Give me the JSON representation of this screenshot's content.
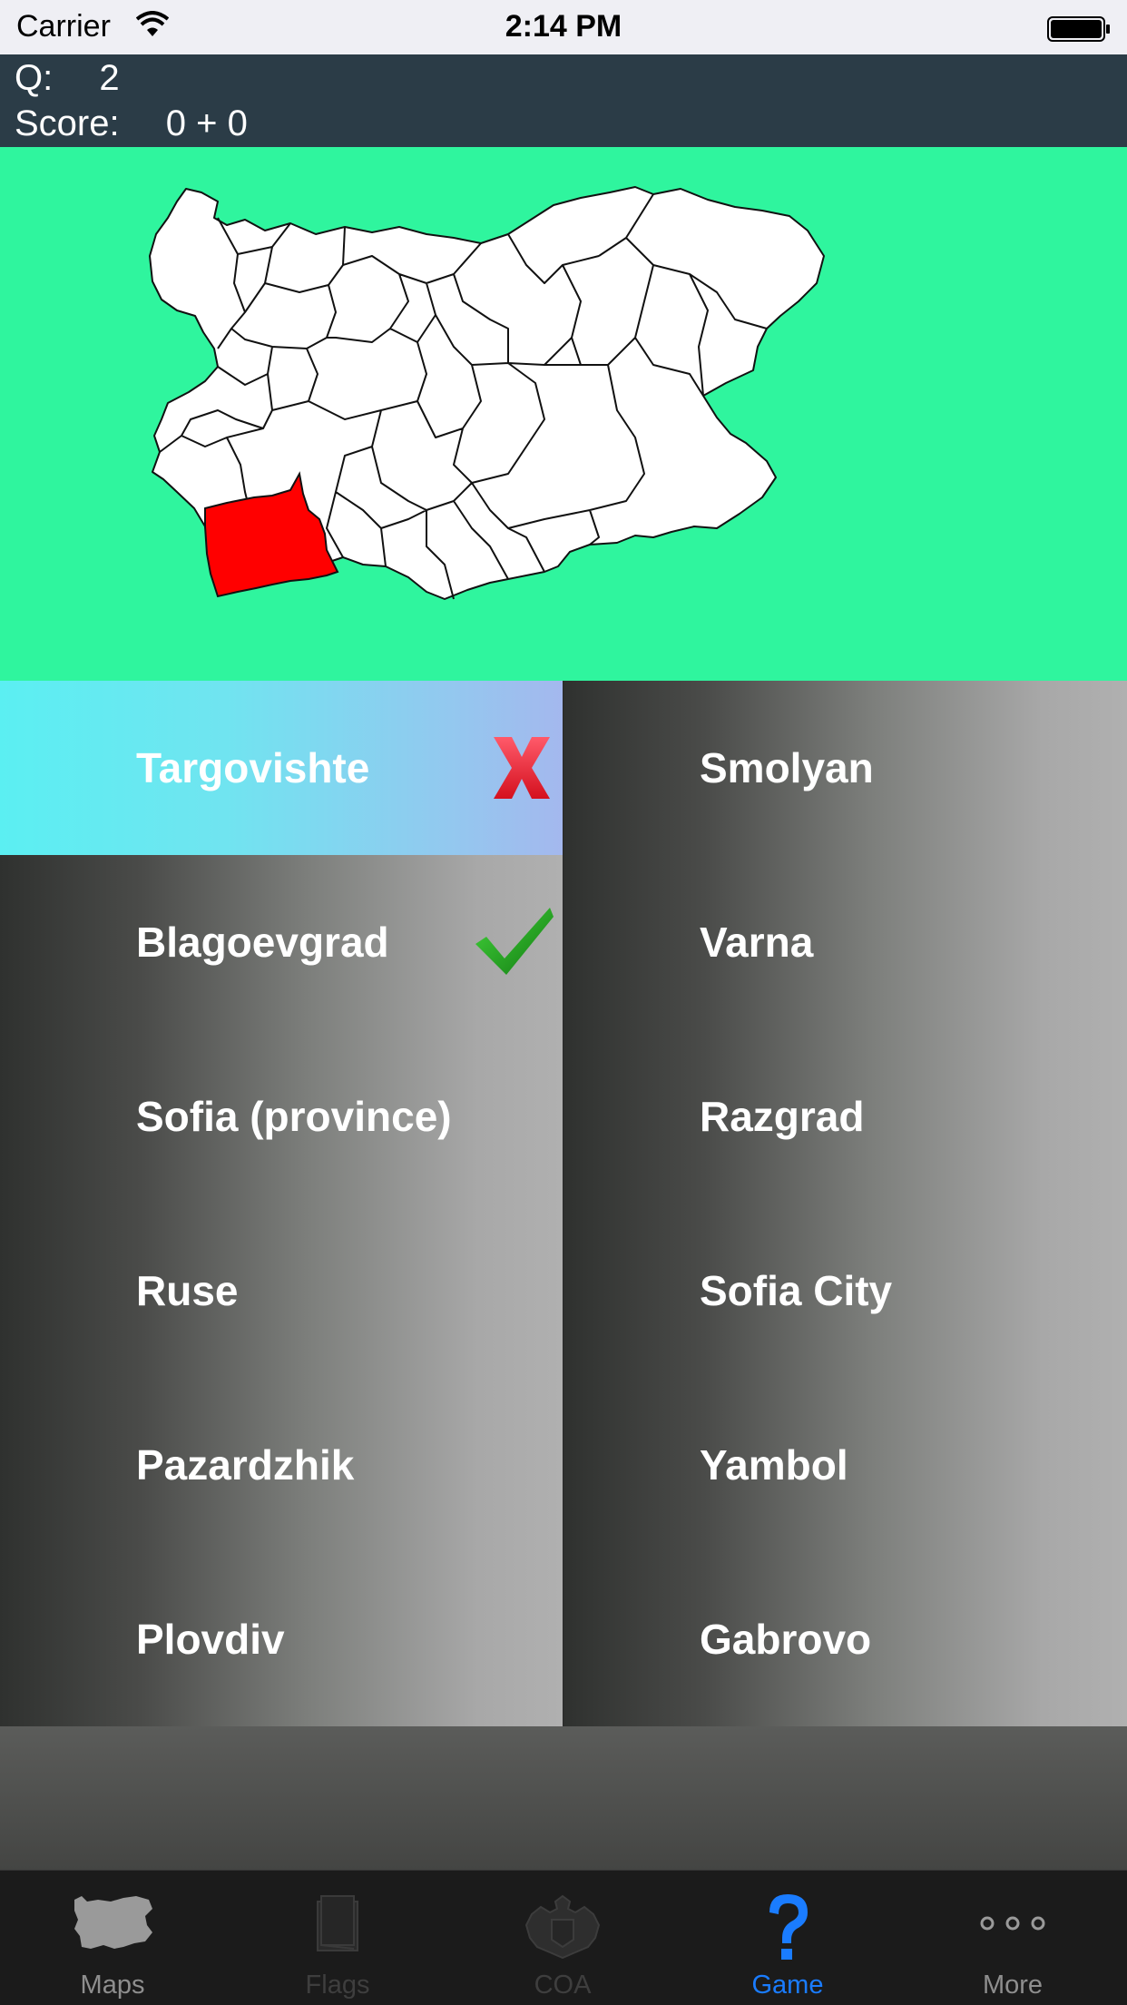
{
  "status_bar": {
    "carrier": "Carrier",
    "time": "2:14 PM"
  },
  "header": {
    "question_label": "Q:",
    "question_number": "2",
    "score_label": "Score:",
    "score_value": "0 + 0"
  },
  "map": {
    "background_color": "#2ff59e",
    "highlight_color": "#ff0000",
    "region_fill": "#ffffff"
  },
  "answers": {
    "left": [
      {
        "label": "Targovishte",
        "state": "wrong"
      },
      {
        "label": "Blagoevgrad",
        "state": "correct"
      },
      {
        "label": "Sofia (province)",
        "state": "none"
      },
      {
        "label": "Ruse",
        "state": "none"
      },
      {
        "label": "Pazardzhik",
        "state": "none"
      },
      {
        "label": "Plovdiv",
        "state": "none"
      }
    ],
    "right": [
      {
        "label": "Smolyan",
        "state": "none"
      },
      {
        "label": "Varna",
        "state": "none"
      },
      {
        "label": "Razgrad",
        "state": "none"
      },
      {
        "label": "Sofia City",
        "state": "none"
      },
      {
        "label": "Yambol",
        "state": "none"
      },
      {
        "label": "Gabrovo",
        "state": "none"
      }
    ]
  },
  "tabs": [
    {
      "label": "Maps",
      "icon": "bulgaria-map-icon",
      "state": "normal"
    },
    {
      "label": "Flags",
      "icon": "flag-icon",
      "state": "dim"
    },
    {
      "label": "COA",
      "icon": "coat-of-arms-icon",
      "state": "dim"
    },
    {
      "label": "Game",
      "icon": "question-mark-icon",
      "state": "active"
    },
    {
      "label": "More",
      "icon": "more-dots-icon",
      "state": "normal"
    }
  ],
  "colors": {
    "accent": "#1a7cff",
    "header_bg": "#2b3c47",
    "wrong_mark": "#e8202a",
    "correct_mark": "#1e9e1e"
  }
}
